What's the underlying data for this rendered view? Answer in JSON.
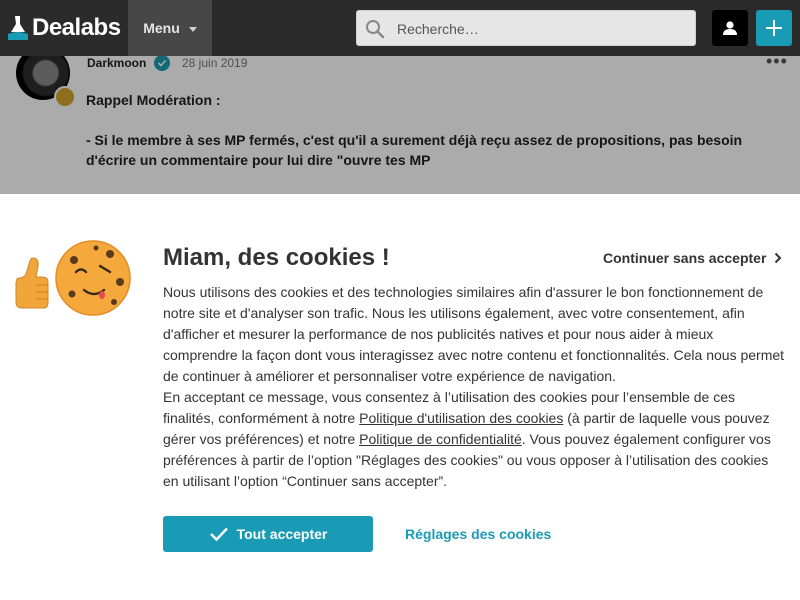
{
  "header": {
    "logo_text": "Dealabs",
    "menu_label": "Menu",
    "search_placeholder": "Recherche…"
  },
  "comment": {
    "author": "Darkmoon",
    "date": "28 juin 2019",
    "more_label": "•••",
    "title": "Rappel Modération :",
    "paragraph": "- Si le membre à ses MP fermés, c'est qu'il a surement déjà reçu assez de propositions, pas besoin d'écrire un commentaire pour lui dire \"ouvre tes MP"
  },
  "cookie": {
    "title": "Miam, des cookies !",
    "continue_label": "Continuer sans accepter",
    "text_1": "Nous utilisons des cookies et des technologies similaires afin d'assurer le bon fonctionnement de notre site et d'analyser son trafic. Nous les utilisons également, avec votre consentement, afin d'afficher et mesurer la performance de nos publicités natives et pour nous aider à mieux comprendre la façon dont vous interagissez avec notre contenu et fonctionnalités. Cela nous permet de continuer à améliorer et personnaliser votre expérience de navigation.",
    "text_2_a": "En acceptant ce message, vous consentez à l’utilisation des cookies pour l’ensemble de ces finalités, conformément à notre ",
    "link_usage": "Politique d'utilisation des cookies",
    "text_2_b": " (à partir de laquelle vous pouvez gérer vos préférences) et notre ",
    "link_privacy": "Politique de confidentialité",
    "text_2_c": ". Vous pouvez également configurer vos préférences à partir de l’option \"Réglages des cookies\" ou vous opposer à l’utilisation des cookies en utilisant l’option “Continuer sans accepter”.",
    "accept_label": "Tout accepter",
    "settings_label": "Réglages des cookies"
  },
  "colors": {
    "header_bg": "#2b2b2b",
    "accent": "#1a9bb5"
  }
}
